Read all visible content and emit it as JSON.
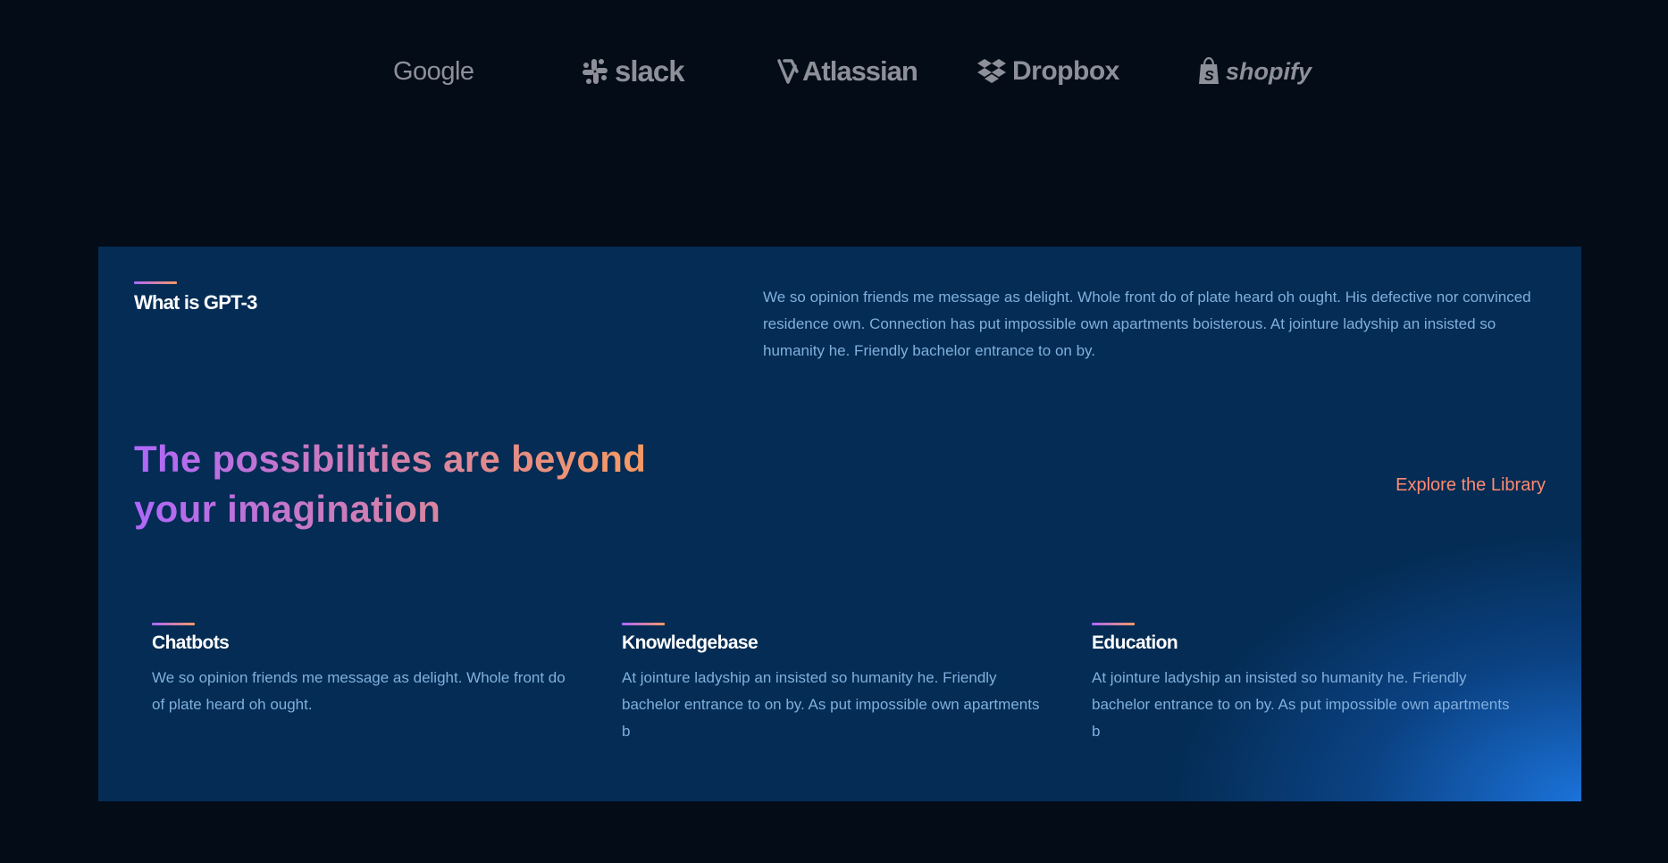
{
  "brands": [
    {
      "name": "Google",
      "icon": "google-logo"
    },
    {
      "name": "slack",
      "icon": "slack-logo"
    },
    {
      "name": "Atlassian",
      "icon": "atlassian-logo"
    },
    {
      "name": "Dropbox",
      "icon": "dropbox-logo"
    },
    {
      "name": "shopify",
      "icon": "shopify-logo"
    }
  ],
  "gpt3": {
    "heading": "What is GPT-3",
    "description": "We so opinion friends me message as delight. Whole front do of plate heard oh ought. His defective nor convinced residence own. Connection has put impossible own apartments boisterous. At jointure ladyship an insisted so humanity he. Friendly bachelor entrance to on by.",
    "possibilities_title": "The possibilities are beyond your imagination",
    "explore_link": "Explore the Library",
    "features": [
      {
        "title": "Chatbots",
        "text": "We so opinion friends me message as delight. Whole front do of plate heard oh ought."
      },
      {
        "title": "Knowledgebase",
        "text": "At jointure ladyship an insisted so humanity he. Friendly bachelor entrance to on by. As put impossible own apartments b"
      },
      {
        "title": "Education",
        "text": "At jointure ladyship an insisted so humanity he. Friendly bachelor entrance to on by. As put impossible own apartments b"
      }
    ]
  },
  "colors": {
    "page_background": "#040c18",
    "section_background": "#042c54",
    "body_text": "#81afdd",
    "link": "#ff8a71",
    "gradient_start": "#ae67fa",
    "gradient_end": "#f49867",
    "brand_logo": "#8d9099"
  }
}
